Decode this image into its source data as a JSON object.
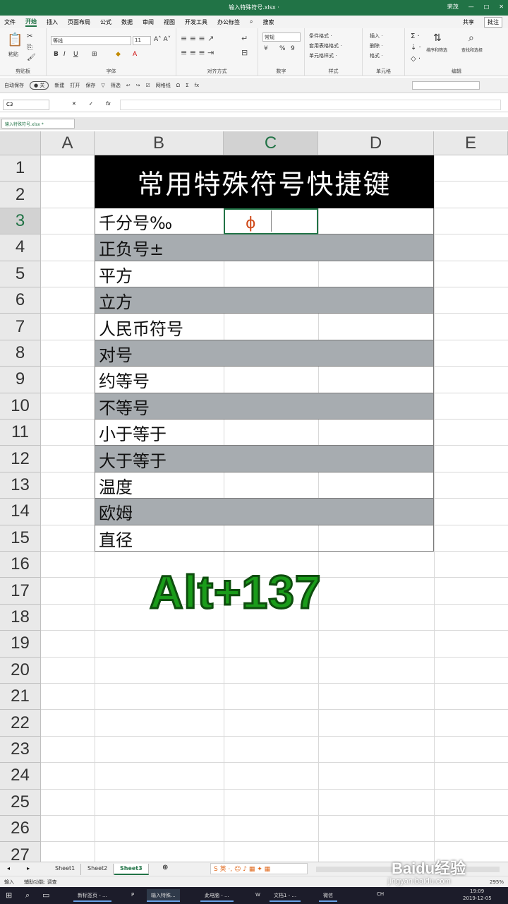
{
  "window": {
    "title": "输入特殊符号.xlsx ·",
    "user": "荣茂",
    "controls": [
      "—",
      "□",
      "✕"
    ]
  },
  "ribbon_tabs": [
    "文件",
    "开始",
    "插入",
    "页面布局",
    "公式",
    "数据",
    "审阅",
    "视图",
    "开发工具",
    "办公标签",
    "搜索"
  ],
  "active_tab": "开始",
  "share": "共享",
  "comment": "批注",
  "ribbon": {
    "clipboard": "剪贴板",
    "paste": "粘贴",
    "font": "字体",
    "font_name": "等线",
    "font_size": "11",
    "align": "对齐方式",
    "number": "数字",
    "number_format": "常规",
    "pct": "%",
    "comma": "9",
    "styles": "样式",
    "cond": "条件格式 ·",
    "table": "套用表格格式 ·",
    "cellstyle": "单元格样式 ·",
    "cells": "单元格",
    "insert": "插入 ·",
    "delete": "删除 ·",
    "format": "格式 ·",
    "editing": "编辑",
    "sortfilter": "排序和筛选",
    "findsel": "查找和选择"
  },
  "qat": {
    "autosave": "自动保存",
    "items": [
      "新建",
      "打开",
      "保存",
      "筛选",
      "↩",
      "↪",
      "网格线"
    ]
  },
  "formula": {
    "namebox": "C3",
    "fx": "fx",
    "cancel": "✕",
    "enter": "✓"
  },
  "doctab": "输入特殊符号.xlsx *",
  "columns": [
    "A",
    "B",
    "C",
    "D",
    "E"
  ],
  "selected_column": "C",
  "selected_row": "3",
  "rows": [
    "1",
    "2",
    "3",
    "4",
    "5",
    "6",
    "7",
    "8",
    "9",
    "10",
    "11",
    "12",
    "13",
    "14",
    "15",
    "16",
    "17",
    "18",
    "19",
    "20",
    "21",
    "22",
    "23",
    "24",
    "25",
    "26",
    "27"
  ],
  "banner": "常用特殊符号快捷键",
  "items": [
    "千分号‰",
    "正负号±",
    "平方",
    "立方",
    "人民币符号",
    "对号",
    "约等号",
    "不等号",
    "小于等于",
    "大于等于",
    "温度",
    "欧姆",
    "直径"
  ],
  "shortcut": "Alt+137",
  "cursor_glyph": "ɸ",
  "sheets": [
    "Sheet1",
    "Sheet2",
    "Sheet3"
  ],
  "active_sheet": "Sheet3",
  "status": {
    "mode": "输入",
    "accessibility": "辅助功能: 调查",
    "zoom": "295%"
  },
  "taskbar": {
    "items": [
      "新标签页 - ...",
      "输入特殊...",
      "此电脑 - ...",
      "文档1 - ...",
      "微信"
    ],
    "time": "19:09",
    "date": "2019-12-05",
    "lang": "CH"
  },
  "watermark": {
    "brand": "Baidu经验",
    "url": "jingyan.baidu.com"
  },
  "colors": {
    "excel_green": "#217346",
    "band_gray": "#a7acb0",
    "shortcut_green": "#1a9c1a",
    "banner_bg": "#000000"
  }
}
